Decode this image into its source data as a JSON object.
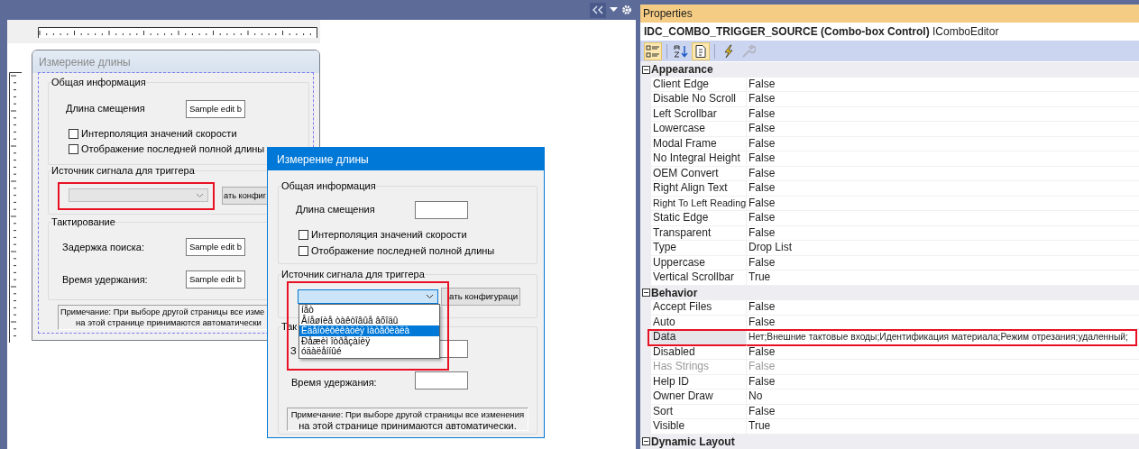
{
  "designer_dialog": {
    "title": "Измерение длины",
    "active": false,
    "general_group": {
      "label": "Общая информация",
      "offset_label": "Длина смещения",
      "offset_value": "Sample edit b",
      "checkboxes": [
        {
          "label": "Интерполяция значений скорости",
          "checked": false
        },
        {
          "label": "Отображение последней полной длины",
          "checked": false
        }
      ]
    },
    "trigger_group": {
      "label": "Источник сигнала для триггера",
      "combo": {
        "disabled": true,
        "highlighted": true
      },
      "button_label": "ать конфиг"
    },
    "clock_group": {
      "label": "Тактирование",
      "search_delay_label": "Задержка поиска:",
      "search_delay_value": "Sample edit b",
      "hold_time_label": "Время удержания:",
      "hold_time_value": "Sample edit b"
    },
    "note": [
      "Примечание: При выборе другой страницы все изме",
      "на этой странице принимаются автоматически"
    ]
  },
  "preview_dialog": {
    "title": "Измерение длины",
    "active": true,
    "general_group": {
      "label": "Общая информация",
      "offset_label": "Длина смещения",
      "checkboxes": [
        {
          "label": "Интерполяция значений скорости",
          "checked": false
        },
        {
          "label": "Отображение последней полной длины",
          "checked": false
        }
      ]
    },
    "trigger_group": {
      "label": "Источник сигнала для триггера",
      "combo": {
        "disabled": false,
        "highlighted": true,
        "expanded": true,
        "options": [
          {
            "label": "íåò",
            "selected": false
          },
          {
            "label": "Âíåøíèå òàêòîâûå âõîäû",
            "selected": false
          },
          {
            "label": "Èäåíòèôèêàöèÿ ìàòåðèàëà",
            "selected": true
          },
          {
            "label": "Ðåæèì îòðåçàíèÿ",
            "selected": false
          },
          {
            "label": "óäàëåííûé",
            "selected": false
          }
        ]
      },
      "button_label": "ать конфигураци"
    },
    "clock_group": {
      "label": "Так",
      "search_delay_label": "З",
      "hold_time_label": "Время удержания:"
    },
    "note": [
      "Примечание: При выборе другой страницы все изменения",
      "на этой странице принимаются автоматически."
    ]
  },
  "properties": {
    "title": "Properties",
    "object_name": "IDC_COMBO_TRIGGER_SOURCE (Combo-box Control)",
    "object_type": "IComboEditor",
    "toolbar": [
      {
        "kind": "categorized",
        "selected": true,
        "disabled": false
      },
      {
        "kind": "alphabetical",
        "selected": false,
        "disabled": false
      },
      {
        "kind": "properties",
        "selected": true,
        "disabled": false
      },
      {
        "kind": "events",
        "selected": false,
        "disabled": false
      },
      {
        "kind": "property-pages",
        "selected": false,
        "disabled": true
      }
    ],
    "categories": [
      {
        "name": "Appearance",
        "expanded": true,
        "properties": [
          {
            "name": "Client Edge",
            "value": "False",
            "disabled": false,
            "selected": false,
            "highlighted": false
          },
          {
            "name": "Disable No Scroll",
            "value": "False",
            "disabled": false,
            "selected": false,
            "highlighted": false
          },
          {
            "name": "Left Scrollbar",
            "value": "False",
            "disabled": false,
            "selected": false,
            "highlighted": false
          },
          {
            "name": "Lowercase",
            "value": "False",
            "disabled": false,
            "selected": false,
            "highlighted": false
          },
          {
            "name": "Modal Frame",
            "value": "False",
            "disabled": false,
            "selected": false,
            "highlighted": false
          },
          {
            "name": "No Integral Height",
            "value": "False",
            "disabled": false,
            "selected": false,
            "highlighted": false
          },
          {
            "name": "OEM Convert",
            "value": "False",
            "disabled": false,
            "selected": false,
            "highlighted": false
          },
          {
            "name": "Right Align Text",
            "value": "False",
            "disabled": false,
            "selected": false,
            "highlighted": false
          },
          {
            "name": "Right To Left Reading",
            "value": "False",
            "disabled": false,
            "selected": false,
            "highlighted": false
          },
          {
            "name": "Static Edge",
            "value": "False",
            "disabled": false,
            "selected": false,
            "highlighted": false
          },
          {
            "name": "Transparent",
            "value": "False",
            "disabled": false,
            "selected": false,
            "highlighted": false
          },
          {
            "name": "Type",
            "value": "Drop List",
            "disabled": false,
            "selected": false,
            "highlighted": false
          },
          {
            "name": "Uppercase",
            "value": "False",
            "disabled": false,
            "selected": false,
            "highlighted": false
          },
          {
            "name": "Vertical Scrollbar",
            "value": "True",
            "disabled": false,
            "selected": false,
            "highlighted": false
          }
        ]
      },
      {
        "name": "Behavior",
        "expanded": true,
        "properties": [
          {
            "name": "Accept Files",
            "value": "False",
            "disabled": false,
            "selected": false,
            "highlighted": false
          },
          {
            "name": "Auto",
            "value": "False",
            "disabled": false,
            "selected": false,
            "highlighted": false
          },
          {
            "name": "Data",
            "value": "Нет;Внешние тактовые входы;Идентификация материала;Режим отрезания;удаленный;",
            "disabled": false,
            "selected": true,
            "highlighted": true
          },
          {
            "name": "Disabled",
            "value": "False",
            "disabled": false,
            "selected": false,
            "highlighted": false
          },
          {
            "name": "Has Strings",
            "value": "False",
            "disabled": true,
            "selected": false,
            "highlighted": false
          },
          {
            "name": "Help ID",
            "value": "False",
            "disabled": false,
            "selected": false,
            "highlighted": false
          },
          {
            "name": "Owner Draw",
            "value": "No",
            "disabled": false,
            "selected": false,
            "highlighted": false
          },
          {
            "name": "Sort",
            "value": "False",
            "disabled": false,
            "selected": false,
            "highlighted": false
          },
          {
            "name": "Visible",
            "value": "True",
            "disabled": false,
            "selected": false,
            "highlighted": false
          }
        ]
      },
      {
        "name": "Dynamic Layout",
        "expanded": true
      }
    ]
  }
}
